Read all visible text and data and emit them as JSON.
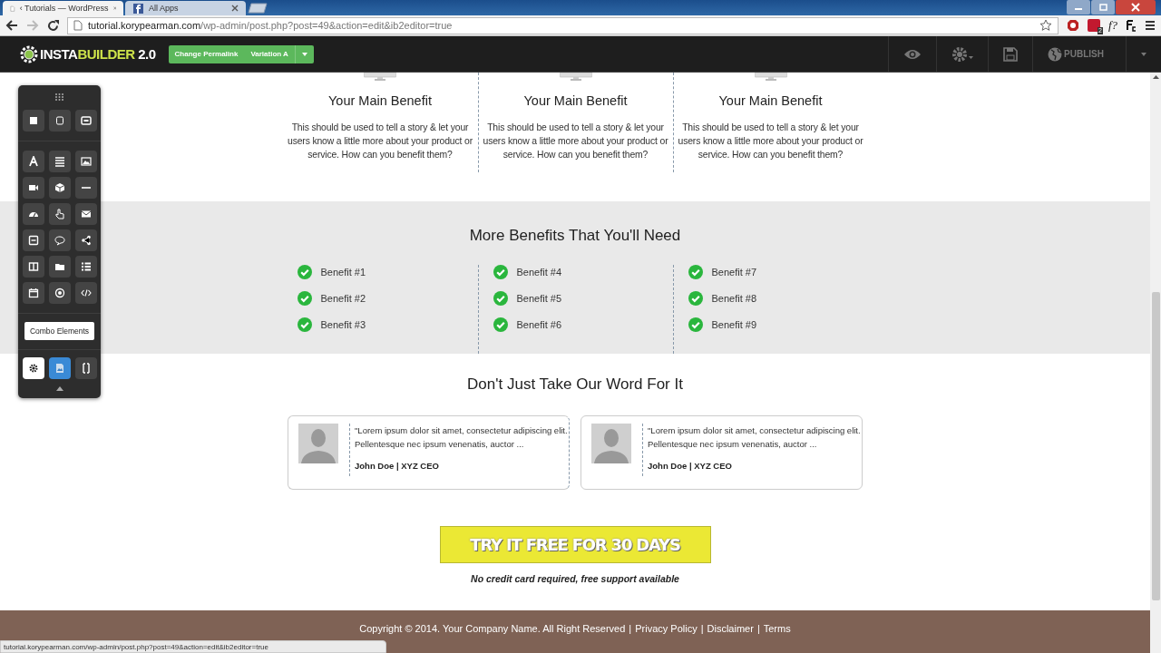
{
  "browser": {
    "tabs": [
      {
        "label": "‹ Tutorials — WordPress",
        "selected": true,
        "kind": "page"
      },
      {
        "label": "All Apps",
        "selected": false,
        "kind": "social"
      }
    ],
    "url_host": "tutorial.korypearman.com",
    "url_path": "/wp-admin/post.php?post=49&action=edit&ib2editor=true",
    "extension_badge": "2",
    "extension_text": "f?"
  },
  "editor_toolbar": {
    "logo": {
      "part_1": "INSTA",
      "part_2": "BUILDER",
      "part_3": "2.0"
    },
    "buttons": [
      "Change Permalink",
      "Variation A"
    ],
    "publish": "PUBLISH"
  },
  "element_panel": {
    "combo_button": "Combo Elements",
    "modes": [
      {
        "kind": "settings",
        "selected": false
      },
      {
        "kind": "image",
        "selected": true
      },
      {
        "kind": "columns",
        "selected": false
      }
    ]
  },
  "features": [
    {
      "title": "Your Main Benefit",
      "text": "This should be used to tell a story & let your users know a little more about your product or service. How can you benefit them?"
    },
    {
      "title": "Your Main Benefit",
      "text": "This should be used to tell a story & let your users know a little more about your product or service. How can you benefit them?"
    },
    {
      "title": "Your Main Benefit",
      "text": "This should be used to tell a story & let your users know a little more about your product or service. How can you benefit them?"
    }
  ],
  "benefits": {
    "title": "More Benefits That You'll Need",
    "columns": [
      [
        "Benefit #1",
        "Benefit #2",
        "Benefit #3"
      ],
      [
        "Benefit #4",
        "Benefit #5",
        "Benefit #6"
      ],
      [
        "Benefit #7",
        "Benefit #8",
        "Benefit #9"
      ]
    ]
  },
  "testimonials": {
    "title": "Don't Just Take Our Word For It",
    "items": [
      {
        "quote": "\"Lorem ipsum dolor sit amet, consectetur adipiscing elit. Pellentesque nec ipsum venenatis, auctor ...",
        "author": "John Doe | XYZ CEO"
      },
      {
        "quote": "\"Lorem ipsum dolor sit amet, consectetur adipiscing elit. Pellentesque nec ipsum venenatis, auctor ...",
        "author": "John Doe | XYZ CEO"
      }
    ]
  },
  "cta": {
    "button": "TRY IT FREE FOR 30 DAYS",
    "note": "No credit card required, free support available"
  },
  "footer": {
    "copyright": "Copyright © 2014. Your Company Name. All Right Reserved",
    "separator": "|",
    "links": [
      "Privacy Policy",
      "Disclaimer",
      "Terms"
    ]
  },
  "status_url": "tutorial.korypearman.com/wp-admin/post.php?post=49&action=edit&ib2editor=true"
}
